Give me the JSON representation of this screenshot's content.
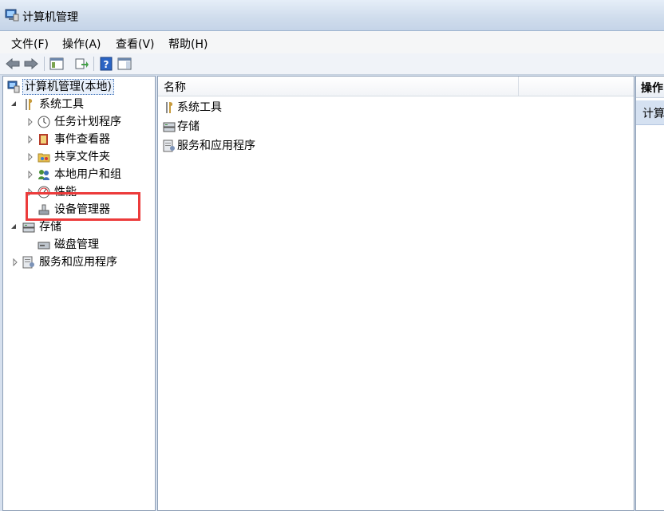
{
  "window": {
    "title": "计算机管理"
  },
  "menu": [
    "文件(F)",
    "操作(A)",
    "查看(V)",
    "帮助(H)"
  ],
  "toolbar": [
    "back-arrow-icon",
    "forward-arrow-icon",
    "show-hide-console-tree-icon",
    "export-list-icon",
    "help-icon",
    "show-hide-action-pane-icon"
  ],
  "tree": {
    "root": "计算机管理(本地)",
    "system_tools": "系统工具",
    "task_scheduler": "任务计划程序",
    "event_viewer": "事件查看器",
    "shared_folders": "共享文件夹",
    "local_users": "本地用户和组",
    "performance": "性能",
    "device_manager": "设备管理器",
    "storage": "存储",
    "disk_management": "磁盘管理",
    "services_apps": "服务和应用程序"
  },
  "list": {
    "column_name": "名称",
    "items": [
      "系统工具",
      "存储",
      "服务和应用程序"
    ]
  },
  "actions": {
    "header": "操作",
    "sub": "计算"
  },
  "colors": {
    "highlight": "#ec3b3b",
    "accent": "#3c6fb7"
  }
}
